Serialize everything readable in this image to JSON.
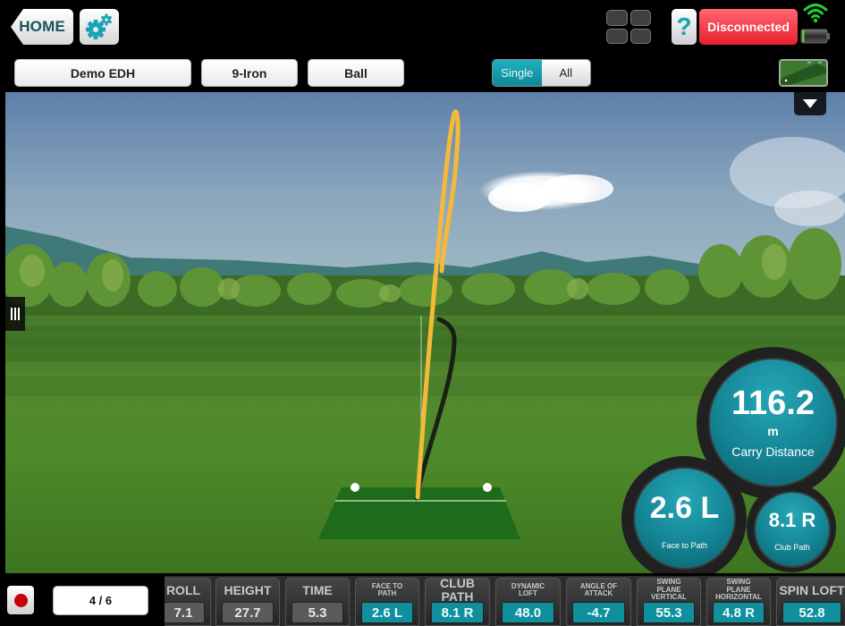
{
  "header": {
    "home_label": "HOME",
    "settings_icon": "gear-icon",
    "layout_icon": "grid-icon",
    "help_label": "?",
    "connection_status": "Disconnected",
    "wifi_icon": "wifi-icon",
    "battery_icon": "battery-icon"
  },
  "selectors": {
    "player": "Demo EDH",
    "club": "9-Iron",
    "ball": "Ball"
  },
  "view_toggle": {
    "options": [
      "Single",
      "All"
    ],
    "selected": "Single"
  },
  "scene": {
    "minimap_icon": "minimap-icon",
    "dropdown_icon": "triangle-down-icon",
    "side_handle_icon": "handle-icon",
    "trajectory_color": "#f5b93a",
    "shadow_color": "#111111"
  },
  "bubbles": {
    "carry": {
      "value": "116.2",
      "unit": "m",
      "label": "Carry Distance"
    },
    "face_to_path": {
      "value": "2.6 L",
      "label": "Face to Path"
    },
    "club_path": {
      "value": "8.1 R",
      "label": "Club Path"
    }
  },
  "bottom": {
    "record_icon": "record-icon",
    "shot_counter": "4 / 6"
  },
  "metrics": [
    {
      "label": "ROLL",
      "value": "7.1",
      "style": "grey",
      "size": "big"
    },
    {
      "label": "HEIGHT",
      "value": "27.7",
      "style": "grey",
      "size": "big"
    },
    {
      "label": "TIME",
      "value": "5.3",
      "style": "grey",
      "size": "big"
    },
    {
      "label": "FACE TO PATH",
      "value": "2.6 L",
      "style": "teal",
      "size": "small"
    },
    {
      "label": "CLUB PATH",
      "value": "8.1 R",
      "style": "teal",
      "size": "big"
    },
    {
      "label": "DYNAMIC LOFT",
      "value": "48.0",
      "style": "teal",
      "size": "small"
    },
    {
      "label": "ANGLE OF ATTACK",
      "value": "-4.7",
      "style": "teal",
      "size": "small"
    },
    {
      "label": "SWING PLANE VERTICAL",
      "value": "55.3",
      "style": "teal",
      "size": "small"
    },
    {
      "label": "SWING PLANE HORIZONTAL",
      "value": "4.8 R",
      "style": "teal",
      "size": "small"
    },
    {
      "label": "SPIN LOFT",
      "value": "52.8",
      "style": "teal",
      "size": "big"
    }
  ],
  "colors": {
    "accent_teal": "#0f909c",
    "disconnected_red": "#e8202e",
    "wifi_green": "#22cc33"
  }
}
